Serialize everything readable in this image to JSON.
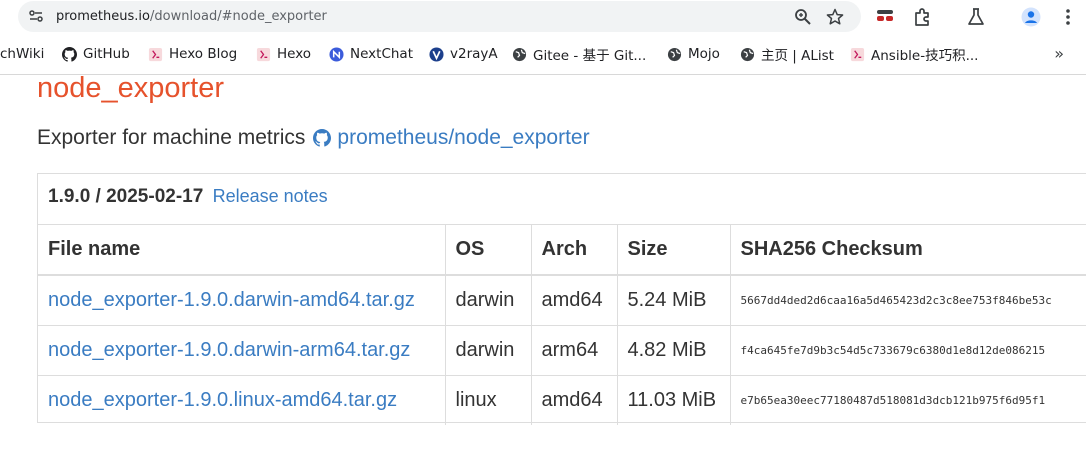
{
  "browser": {
    "url_host": "prometheus.io",
    "url_path": "/download/#node_exporter",
    "bookmarks": [
      {
        "label": "chWiki",
        "icon": "none"
      },
      {
        "label": "GitHub",
        "icon": "github-icon"
      },
      {
        "label": "Hexo Blog",
        "icon": "hexo-icon"
      },
      {
        "label": "Hexo",
        "icon": "hexo-icon"
      },
      {
        "label": "NextChat",
        "icon": "nextchat-icon"
      },
      {
        "label": "v2rayA",
        "icon": "v2raya-icon"
      },
      {
        "label": "Gitee - 基于 Git...",
        "icon": "globe-icon"
      },
      {
        "label": "Mojo",
        "icon": "globe-icon"
      },
      {
        "label": "主页 | AList",
        "icon": "globe-icon"
      },
      {
        "label": "Ansible-技巧积...",
        "icon": "hexo-icon"
      }
    ],
    "more": "»"
  },
  "page": {
    "title": "node_exporter",
    "description": "Exporter for machine metrics",
    "repo_link": "prometheus/node_exporter",
    "release_version": "1.9.0 / 2025-02-17",
    "release_notes": "Release notes",
    "columns": [
      "File name",
      "OS",
      "Arch",
      "Size",
      "SHA256 Checksum"
    ],
    "rows": [
      {
        "file": "node_exporter-1.9.0.darwin-amd64.tar.gz",
        "os": "darwin",
        "arch": "amd64",
        "size": "5.24 MiB",
        "sha": "5667dd4ded2d6caa16a5d465423d2c3c8ee753f846be53c"
      },
      {
        "file": "node_exporter-1.9.0.darwin-arm64.tar.gz",
        "os": "darwin",
        "arch": "arm64",
        "size": "4.82 MiB",
        "sha": "f4ca645fe7d9b3c54d5c733679c6380d1e8d12de086215"
      },
      {
        "file": "node_exporter-1.9.0.linux-amd64.tar.gz",
        "os": "linux",
        "arch": "amd64",
        "size": "11.03 MiB",
        "sha": "e7b65ea30eec77180487d518081d3dcb121b975f6d95f1"
      }
    ]
  },
  "colors": {
    "title": "#e6522c",
    "link": "#3a7cc2",
    "border": "#dddddd"
  }
}
